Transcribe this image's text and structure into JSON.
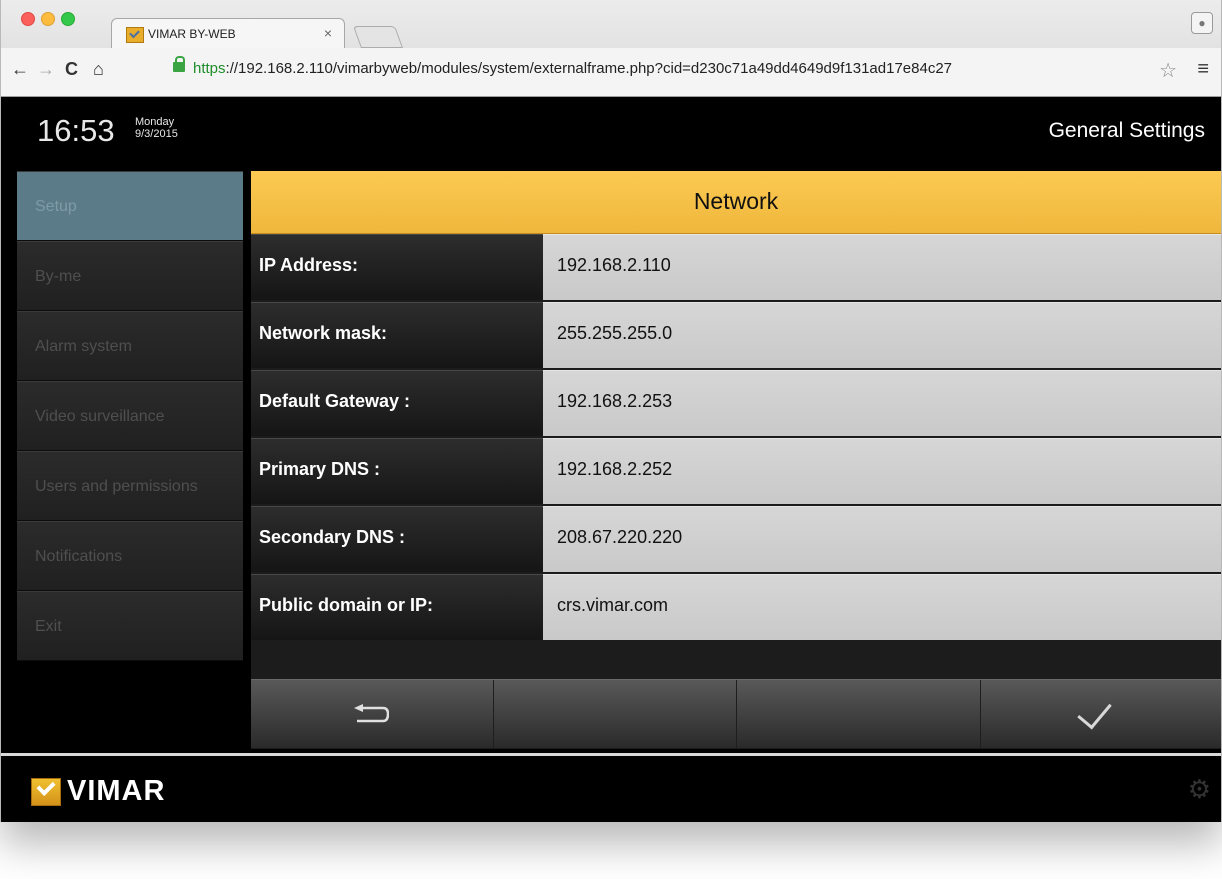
{
  "browser": {
    "tab_title": "VIMAR BY-WEB",
    "tab_close": "×",
    "url_scheme": "https",
    "url_rest": "://192.168.2.110/vimarbyweb/modules/system/externalframe.php?cid=d230c71a49dd4649d9f131ad17e84c27",
    "back_icon": "←",
    "forward_icon": "→",
    "reload_icon": "C",
    "home_icon": "⌂",
    "star_icon": "☆",
    "menu_icon": "≡"
  },
  "header": {
    "time": "16:53",
    "day": "Monday",
    "date": "9/3/2015",
    "title": "General Settings"
  },
  "sidebar": {
    "items": [
      {
        "label": "Setup",
        "active": true
      },
      {
        "label": "By-me",
        "active": false
      },
      {
        "label": "Alarm system",
        "active": false
      },
      {
        "label": "Video surveillance",
        "active": false
      },
      {
        "label": "Users and permissions",
        "active": false
      },
      {
        "label": "Notifications",
        "active": false
      },
      {
        "label": "Exit",
        "active": false
      }
    ]
  },
  "section": {
    "title": "Network",
    "fields": [
      {
        "label": "IP Address:",
        "value": "192.168.2.110"
      },
      {
        "label": "Network mask:",
        "value": "255.255.255.0"
      },
      {
        "label": "Default Gateway :",
        "value": "192.168.2.253"
      },
      {
        "label": "Primary DNS :",
        "value": "192.168.2.252"
      },
      {
        "label": "Secondary DNS :",
        "value": "208.67.220.220"
      },
      {
        "label": "Public domain or IP:",
        "value": "crs.vimar.com"
      }
    ]
  },
  "footer": {
    "brand": "VIMAR",
    "settings_icon": "⚙"
  },
  "colors": {
    "accent_header": "#f7c046",
    "sidebar_active": "#5b7b89",
    "value_bg": "#d0d0d0"
  }
}
